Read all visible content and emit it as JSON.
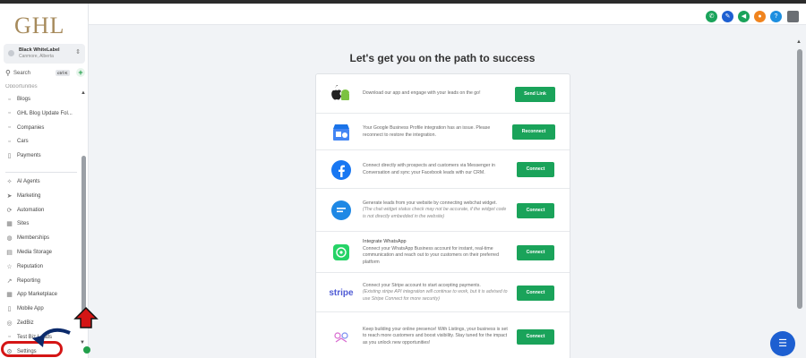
{
  "app": {
    "logo": "GHL"
  },
  "account": {
    "name": "Black WhiteLabel",
    "location": "Canmore, Alberta"
  },
  "search": {
    "label": "Search",
    "shortcut": "ctrl K",
    "add": "+"
  },
  "sidebar": {
    "partial_item": "Opportunities",
    "items_top": [
      {
        "label": "Blogs",
        "icon": "page-icon"
      },
      {
        "label": "GHL Blog Update Fol...",
        "icon": "page-icon"
      },
      {
        "label": "Companies",
        "icon": "page-icon"
      },
      {
        "label": "Cars",
        "icon": "page-icon"
      },
      {
        "label": "Payments",
        "icon": "payments-icon"
      }
    ],
    "items_bottom": [
      {
        "label": "AI Agents",
        "icon": "ai-icon"
      },
      {
        "label": "Marketing",
        "icon": "send-icon"
      },
      {
        "label": "Automation",
        "icon": "automation-icon"
      },
      {
        "label": "Sites",
        "icon": "sites-icon"
      },
      {
        "label": "Memberships",
        "icon": "memberships-icon"
      },
      {
        "label": "Media Storage",
        "icon": "media-icon"
      },
      {
        "label": "Reputation",
        "icon": "star-icon"
      },
      {
        "label": "Reporting",
        "icon": "chart-icon"
      },
      {
        "label": "App Marketplace",
        "icon": "grid-icon"
      },
      {
        "label": "Mobile App",
        "icon": "mobile-icon"
      },
      {
        "label": "ZedBiz",
        "icon": "zedbiz-icon"
      },
      {
        "label": "Test Biz Leads",
        "icon": "page-icon"
      },
      {
        "label": "Settings",
        "icon": "gear-icon"
      }
    ]
  },
  "topbar": {
    "icons": [
      {
        "name": "phone-icon",
        "glyph": "✆",
        "color": "#1aa35a"
      },
      {
        "name": "magic-wand-icon",
        "glyph": "✎",
        "color": "#1d5fd1"
      },
      {
        "name": "megaphone-icon",
        "glyph": "◀",
        "color": "#1aa35a"
      },
      {
        "name": "bell-icon",
        "glyph": "●",
        "color": "#f0841e"
      },
      {
        "name": "help-icon",
        "glyph": "?",
        "color": "#1d8fe0"
      },
      {
        "name": "user-avatar-icon",
        "glyph": "",
        "color": "#555555"
      }
    ]
  },
  "main": {
    "title": "Let's get you on the path to success",
    "rows": [
      {
        "icon": "apple-android-icon",
        "text": "Download our app and engage with your leads on the go!",
        "button": "Send Link"
      },
      {
        "icon": "google-business-icon",
        "text": "Your Google Business Profile integration has an issue. Please reconnect to restore the integration.",
        "button": "Reconnect"
      },
      {
        "icon": "facebook-icon",
        "text": "Connect directly with prospects and customers via Messenger in Conversation and sync your Facebook leads with our CRM.",
        "button": "Connect"
      },
      {
        "icon": "webchat-icon",
        "text": "Generate leads from your website by connecting webchat widget.",
        "note": "(The chat widget status check may not be accurate, if the widget code is not directly embedded in the website)",
        "button": "Connect"
      },
      {
        "icon": "whatsapp-icon",
        "title": "Integrate WhatsApp",
        "text": "Connect your WhatsApp Business account for instant, real-time communication and reach out to your customers on their preferred platform",
        "button": "Connect"
      },
      {
        "icon": "stripe-icon",
        "icon_text": "stripe",
        "text": "Connect your Stripe account to start accepting payments.",
        "note": "(Existing stripe API integration will continue to work, but it is advised to use Stripe Connect for more security)",
        "button": "Connect"
      },
      {
        "icon": "listings-icon",
        "text": "Keep building your online presence! With Listings, your business is set to reach more customers and boost visibility. Stay tuned for the impact as you unlock new opportunities!",
        "button": "Connect"
      }
    ]
  },
  "colors": {
    "accent": "#1aa35a",
    "brand": "#a68a5b",
    "highlight": "#d41515",
    "fab": "#1d5fd1"
  }
}
